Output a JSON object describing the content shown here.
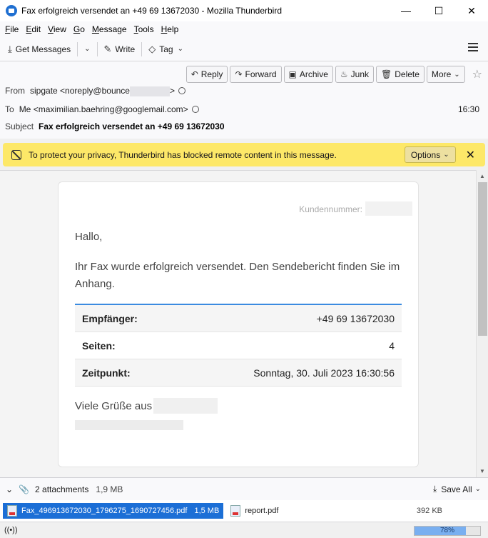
{
  "window": {
    "title": "Fax erfolgreich versendet an +49 69 13672030 - Mozilla Thunderbird",
    "minimize": "—",
    "maximize": "☐",
    "close": "✕"
  },
  "menu": [
    {
      "label": "File",
      "u": "F",
      "rest": "ile"
    },
    {
      "label": "Edit",
      "u": "E",
      "rest": "dit"
    },
    {
      "label": "View",
      "u": "V",
      "rest": "iew"
    },
    {
      "label": "Go",
      "u": "G",
      "rest": "o"
    },
    {
      "label": "Message",
      "u": "M",
      "rest": "essage"
    },
    {
      "label": "Tools",
      "u": "T",
      "rest": "ools"
    },
    {
      "label": "Help",
      "u": "H",
      "rest": "elp"
    }
  ],
  "toolbar": {
    "get_messages": "Get Messages",
    "write": "Write",
    "tag": "Tag"
  },
  "actions": {
    "reply": "Reply",
    "forward": "Forward",
    "archive": "Archive",
    "junk": "Junk",
    "delete": "Delete",
    "more": "More"
  },
  "header": {
    "from_label": "From",
    "from_name": "sipgate",
    "from_addr_prefix": "<noreply@bounce",
    "from_addr_suffix": ">",
    "to_label": "To",
    "to_value": "Me <maximilian.baehring@googlemail.com>",
    "time": "16:30",
    "subject_label": "Subject",
    "subject_value": "Fax erfolgreich versendet an +49 69 13672030"
  },
  "notification": {
    "text": "To protect your privacy, Thunderbird has blocked remote content in this message.",
    "options": "Options",
    "close": "✕"
  },
  "email": {
    "kundennummer": "Kundennummer:",
    "greeting": "Hallo,",
    "paragraph": "Ihr Fax wurde erfolgreich versendet. Den Sendebericht finden Sie im Anhang.",
    "rows": [
      {
        "key": "Empfänger:",
        "value": "+49 69 13672030"
      },
      {
        "key": "Seiten:",
        "value": "4"
      },
      {
        "key": "Zeitpunkt:",
        "value": "Sonntag, 30. Juli 2023 16:30:56"
      }
    ],
    "closing": "Viele Grüße aus"
  },
  "attachments": {
    "count_label": "2 attachments",
    "total_size": "1,9 MB",
    "save_all": "Save All",
    "items": [
      {
        "name": "Fax_496913672030_1796275_1690727456.pdf",
        "size": "1,5 MB"
      },
      {
        "name": "report.pdf",
        "size": "392 KB"
      }
    ]
  },
  "status": {
    "progress_percent": 78,
    "progress_label": "78%"
  }
}
